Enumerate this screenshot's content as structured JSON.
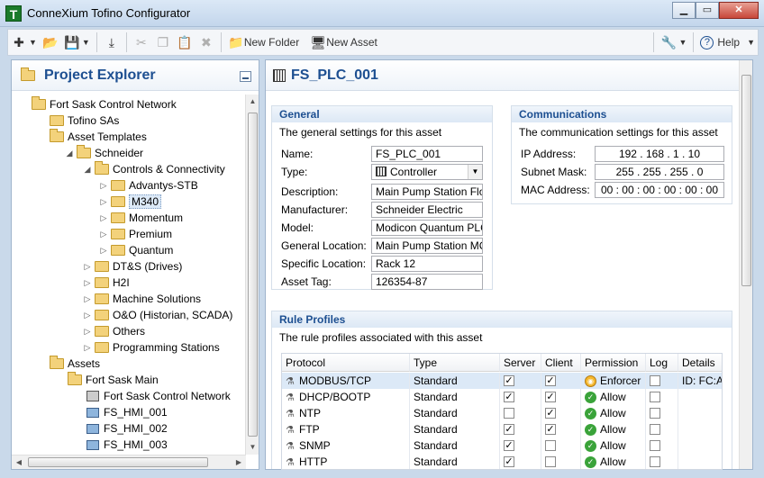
{
  "window": {
    "title": "ConneXium Tofino Configurator",
    "min": "▁",
    "max": "▭",
    "close": "✕"
  },
  "toolbar": {
    "new_folder": "New Folder",
    "new_asset": "New Asset",
    "help": "Help"
  },
  "explorer": {
    "title": "Project Explorer",
    "items": [
      "Fort Sask Control Network",
      "Tofino SAs",
      "Asset Templates",
      "Schneider",
      "Controls & Connectivity",
      "Advantys-STB",
      "M340",
      "Momentum",
      "Premium",
      "Quantum",
      "DT&S (Drives)",
      "H2I",
      "Machine Solutions",
      "O&O (Historian, SCADA)",
      "Others",
      "Programming Stations",
      "Assets",
      "Fort Sask Main",
      "Fort Sask Control Network",
      "FS_HMI_001",
      "FS_HMI_002",
      "FS_HMI_003"
    ]
  },
  "editor": {
    "title": "FS_PLC_001",
    "general": {
      "title": "General",
      "desc": "The general settings for this asset",
      "labels": [
        "Name:",
        "Type:",
        "Description:",
        "Manufacturer:",
        "Model:",
        "General Location:",
        "Specific Location:",
        "Asset Tag:"
      ],
      "values": [
        "FS_PLC_001",
        "Controller",
        "Main Pump Station Flo",
        "Schneider Electric",
        "Modicon Quantum PLC",
        "Main Pump Station MC",
        "Rack 12",
        "126354-87"
      ]
    },
    "comms": {
      "title": "Communications",
      "desc": "The communication settings for this asset",
      "labels": [
        "IP Address:",
        "Subnet Mask:",
        "MAC Address:"
      ],
      "values": [
        "192  .  168  .   1   .  10",
        "255  .  255  .  255  .   0",
        "00 : 00 : 00 : 00 : 00 : 00"
      ]
    },
    "rules": {
      "title": "Rule Profiles",
      "desc": "The rule profiles associated with this asset",
      "headers": [
        "Protocol",
        "Type",
        "Server",
        "Client",
        "Permission",
        "Log",
        "Details"
      ],
      "rows": [
        {
          "protocol": "MODBUS/TCP",
          "type": "Standard",
          "server": true,
          "client": true,
          "permission": "Enforcer",
          "log": false,
          "details": "ID: FC:A"
        },
        {
          "protocol": "DHCP/BOOTP",
          "type": "Standard",
          "server": true,
          "client": true,
          "permission": "Allow",
          "log": false,
          "details": ""
        },
        {
          "protocol": "NTP",
          "type": "Standard",
          "server": false,
          "client": true,
          "permission": "Allow",
          "log": false,
          "details": ""
        },
        {
          "protocol": "FTP",
          "type": "Standard",
          "server": true,
          "client": true,
          "permission": "Allow",
          "log": false,
          "details": ""
        },
        {
          "protocol": "SNMP",
          "type": "Standard",
          "server": true,
          "client": false,
          "permission": "Allow",
          "log": false,
          "details": ""
        },
        {
          "protocol": "HTTP",
          "type": "Standard",
          "server": true,
          "client": false,
          "permission": "Allow",
          "log": false,
          "details": ""
        }
      ]
    }
  }
}
